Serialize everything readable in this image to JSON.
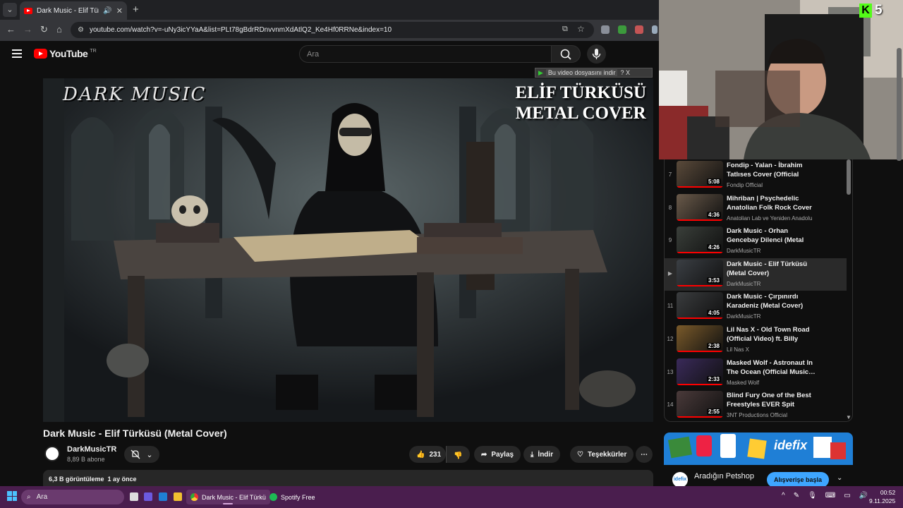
{
  "browser": {
    "tab_title": "Dark Music - Elif Türküsü (M",
    "url": "youtube.com/watch?v=-uNy3icYYaA&list=PLt78gBdrRDnvvnmXdAtlQ2_Ke4Hf0RRNe&index=10"
  },
  "youtube": {
    "logo_text": "YouTube",
    "country": "TR",
    "search_placeholder": "Ara",
    "download_bar": "Bu video dosyasını indir",
    "download_bar_extra": "? X"
  },
  "video": {
    "art_left": "DARK MUSIC",
    "art_right_line1": "ELİF TÜRKÜSÜ",
    "art_right_line2": "METAL COVER",
    "title": "Dark Music - Elif Türküsü (Metal Cover)",
    "channel": "DarkMusicTR",
    "subscribers": "8,89 B abone",
    "likes": "231",
    "share": "Paylaş",
    "download": "İndir",
    "thanks": "Teşekkürler",
    "more": "⋯",
    "stats": "6,3 B görüntüleme  1 ay önce"
  },
  "playlist": {
    "items": [
      {
        "idx": "7",
        "title": "Fondip - Yalan - İbrahim Tatlıses Cover (Official Audio)",
        "channel": "Fondip Official",
        "duration": "5:08",
        "color": "#5a4a3a",
        "active": false
      },
      {
        "idx": "8",
        "title": "Mihriban | Psychedelic Anatolian Folk Rock Cover",
        "channel": "Anatolian Lab ve Yeniden Anadolu",
        "duration": "4:36",
        "color": "#6a5a4a",
        "active": false
      },
      {
        "idx": "9",
        "title": "Dark Music - Orhan Gencebay Dilenci (Metal Cover)",
        "channel": "DarkMusicTR",
        "duration": "4:26",
        "color": "#3a3f3a",
        "active": false
      },
      {
        "idx": "▶",
        "title": "Dark Music - Elif Türküsü (Metal Cover)",
        "channel": "DarkMusicTR",
        "duration": "3:53",
        "color": "#3b3f44",
        "active": true
      },
      {
        "idx": "11",
        "title": "Dark Music - Çırpınırdı Karadeniz (Metal Cover)",
        "channel": "DarkMusicTR",
        "duration": "4:05",
        "color": "#3a3c3e",
        "active": false
      },
      {
        "idx": "12",
        "title": "Lil Nas X - Old Town Road (Official Video) ft. Billy Ray…",
        "channel": "Lil Nas X",
        "duration": "2:38",
        "color": "#7a5a2a",
        "active": false
      },
      {
        "idx": "13",
        "title": "Masked Wolf - Astronaut In The Ocean (Official Music…",
        "channel": "Masked Wolf",
        "duration": "2:33",
        "color": "#3a2a5a",
        "active": false
      },
      {
        "idx": "14",
        "title": "Blind Fury One of the Best Freestyles EVER Spit",
        "channel": "3NT Productions Official",
        "duration": "2:55",
        "color": "#4a3a3a",
        "active": false
      }
    ]
  },
  "ad": {
    "brand": "idefix",
    "logo": "idefix",
    "title": "Aradığın Petshop",
    "cta": "Alışverişe başla"
  },
  "webcam": {
    "badge_letter": "K",
    "badge_number": "5"
  },
  "taskbar": {
    "search": "Ara",
    "app1": "Dark Music - Elif Türkü",
    "app2": "Spotify Free",
    "time": "00:52",
    "date": "9.11.2025"
  }
}
